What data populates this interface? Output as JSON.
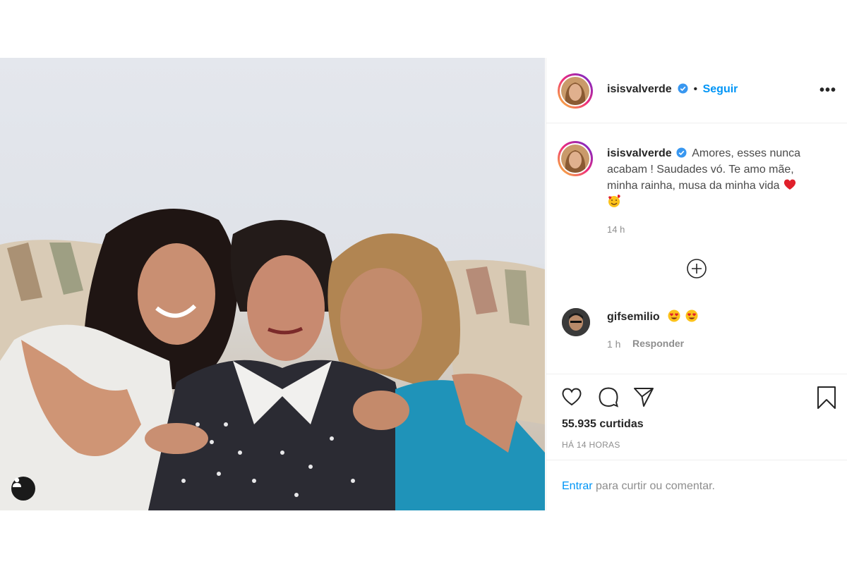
{
  "post": {
    "author": "isisvalverde",
    "follow_label": "Seguir",
    "more_label": "•••",
    "caption": "Amores, esses nunca acabam ! Saudades vó. Te amo mãe, minha rainha, musa da minha vida",
    "caption_time": "14 h",
    "likes": "55.935 curtidas",
    "posted_ago": "HÁ 14 HORAS"
  },
  "comments": [
    {
      "author": "gifsemilio",
      "time": "1 h",
      "reply_label": "Responder"
    }
  ],
  "login": {
    "link": "Entrar",
    "text": " para curtir ou comentar."
  },
  "icons": {
    "verified": "verified-badge-icon",
    "like": "heart-icon",
    "comment": "comment-bubble-icon",
    "share": "paper-plane-icon",
    "save": "bookmark-icon",
    "load_more": "plus-circle-icon",
    "tag": "user-tag-icon"
  },
  "colors": {
    "accent": "#0095f6",
    "muted": "#8e8e8e",
    "text": "#262626",
    "border": "#efefef"
  }
}
